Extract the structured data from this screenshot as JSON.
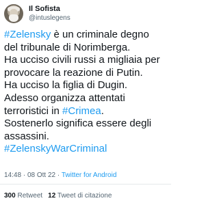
{
  "author": {
    "display_name": "Il Sofista",
    "handle": "@intuslegens",
    "avatar_icon": "bearded-man-avatar"
  },
  "tweet": {
    "lines": [
      [
        {
          "text": "#Zelensky",
          "hashtag": true
        },
        {
          "text": " è un criminale degno",
          "hashtag": false
        }
      ],
      [
        {
          "text": "del tribunale di Norimberga.",
          "hashtag": false
        }
      ],
      [
        {
          "text": "Ha ucciso civili russi a migliaia per",
          "hashtag": false
        }
      ],
      [
        {
          "text": "provocare la reazione di Putin.",
          "hashtag": false
        }
      ],
      [
        {
          "text": "Ha ucciso la figlia di Dugin.",
          "hashtag": false
        }
      ],
      [
        {
          "text": "Adesso organizza attentati",
          "hashtag": false
        }
      ],
      [
        {
          "text": "terroristici in ",
          "hashtag": false
        },
        {
          "text": "#Crimea",
          "hashtag": true
        },
        {
          "text": ".",
          "hashtag": false
        }
      ],
      [
        {
          "text": "Sostenerlo significa essere degli",
          "hashtag": false
        }
      ],
      [
        {
          "text": "assassini.",
          "hashtag": false
        }
      ],
      [
        {
          "text": "#ZelenskyWarCriminal",
          "hashtag": true
        }
      ]
    ],
    "time": "14:48",
    "separator": "·",
    "date": "08 Ott 22",
    "source": "Twitter for Android"
  },
  "stats": {
    "retweets_count": "300",
    "retweets_label": "Retweet",
    "quotes_count": "12",
    "quotes_label": "Tweet di citazione"
  },
  "colors": {
    "text": "#0f1419",
    "secondary": "#536471",
    "link": "#1d9bf0"
  }
}
